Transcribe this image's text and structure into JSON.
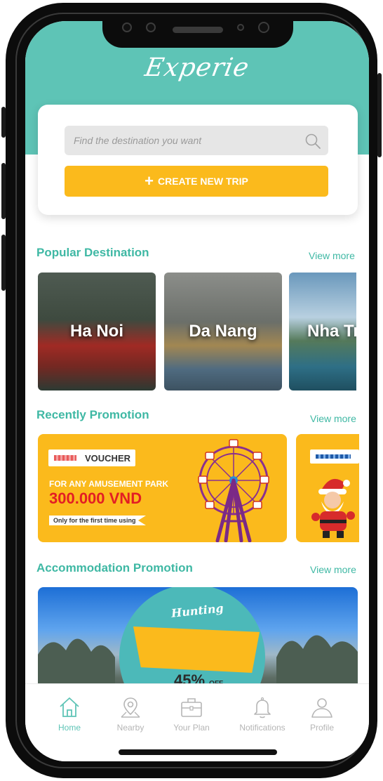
{
  "app": {
    "title": "Experie"
  },
  "search": {
    "placeholder": "Find the destination you want",
    "create_trip_label": "CREATE NEW TRIP",
    "create_trip_icon": "plus-icon"
  },
  "popular": {
    "title": "Popular Destination",
    "view_more": "View more",
    "items": [
      {
        "label": "Ha Noi"
      },
      {
        "label": "Da Nang"
      },
      {
        "label": "Nha Tr"
      }
    ]
  },
  "promotions": {
    "title": "Recently Promotion",
    "view_more": "View more",
    "card": {
      "tag": "VOUCHER",
      "line1": "FOR ANY AMUSEMENT PARK",
      "price": "300.000 VND",
      "note": "Only for the first time using"
    }
  },
  "accommodation": {
    "title": "Accommodation Promotion",
    "view_more": "View more",
    "banner": {
      "headline": "Hunting",
      "discount": "45%",
      "discount_suffix": "OFF"
    }
  },
  "nav": {
    "items": [
      {
        "label": "Home",
        "icon": "home-icon",
        "active": true
      },
      {
        "label": "Nearby",
        "icon": "map-pin-icon",
        "active": false
      },
      {
        "label": "Your Plan",
        "icon": "briefcase-icon",
        "active": false
      },
      {
        "label": "Notifications",
        "icon": "bell-icon",
        "active": false
      },
      {
        "label": "Profile",
        "icon": "user-icon",
        "active": false
      }
    ]
  },
  "colors": {
    "brand": "#5ec4b6",
    "heading": "#3fb8a4",
    "accent": "#fbba1c",
    "price": "#e31e24"
  }
}
